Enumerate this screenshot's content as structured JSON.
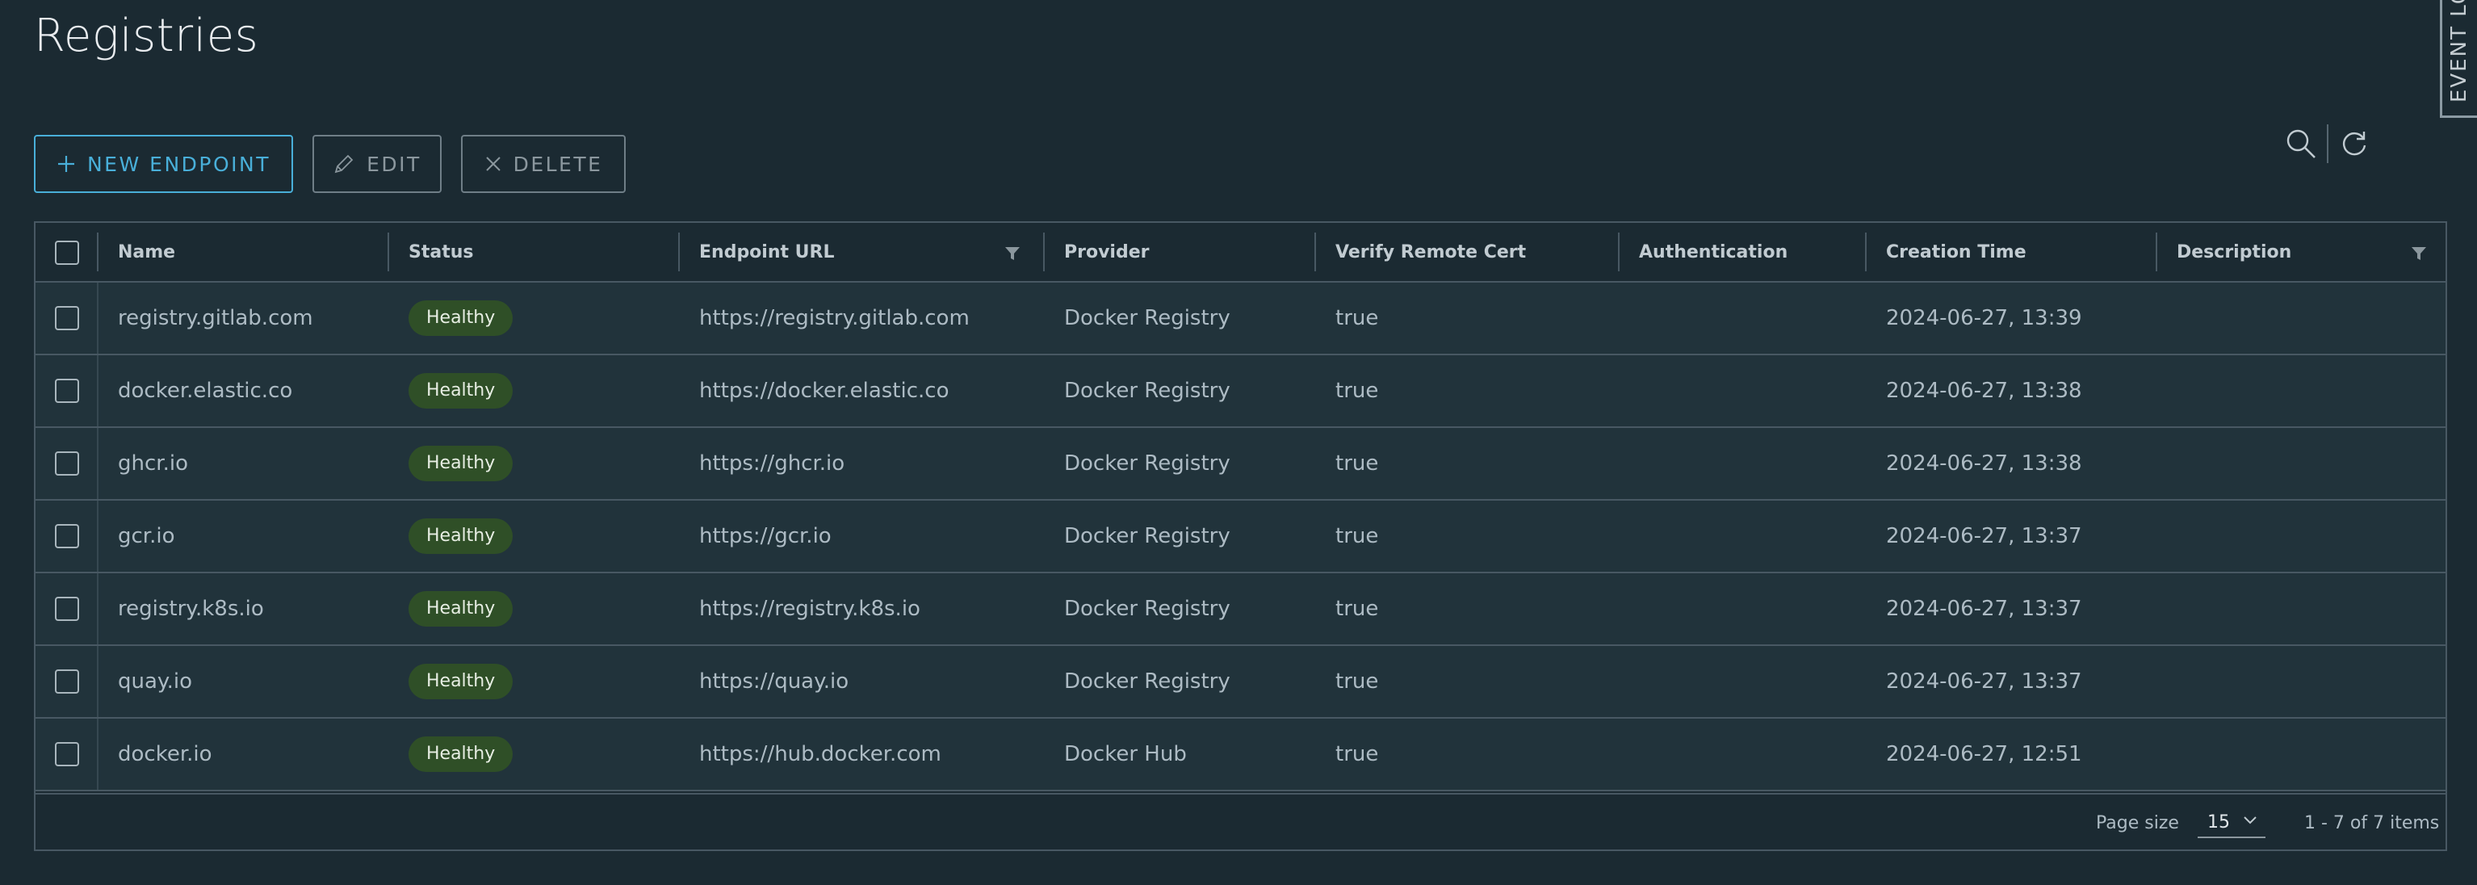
{
  "page": {
    "title": "Registries"
  },
  "event_tab": {
    "label": "EVENT LOG"
  },
  "toolbar": {
    "new_label": "NEW ENDPOINT",
    "edit_label": "EDIT",
    "delete_label": "DELETE"
  },
  "table": {
    "columns": [
      "Name",
      "Status",
      "Endpoint URL",
      "Provider",
      "Verify Remote Cert",
      "Authentication",
      "Creation Time",
      "Description"
    ],
    "rows": [
      {
        "name": "registry.gitlab.com",
        "status": "Healthy",
        "url": "https://registry.gitlab.com",
        "provider": "Docker Registry",
        "verify": "true",
        "auth": "",
        "created": "2024-06-27, 13:39",
        "description": ""
      },
      {
        "name": "docker.elastic.co",
        "status": "Healthy",
        "url": "https://docker.elastic.co",
        "provider": "Docker Registry",
        "verify": "true",
        "auth": "",
        "created": "2024-06-27, 13:38",
        "description": ""
      },
      {
        "name": "ghcr.io",
        "status": "Healthy",
        "url": "https://ghcr.io",
        "provider": "Docker Registry",
        "verify": "true",
        "auth": "",
        "created": "2024-06-27, 13:38",
        "description": ""
      },
      {
        "name": "gcr.io",
        "status": "Healthy",
        "url": "https://gcr.io",
        "provider": "Docker Registry",
        "verify": "true",
        "auth": "",
        "created": "2024-06-27, 13:37",
        "description": ""
      },
      {
        "name": "registry.k8s.io",
        "status": "Healthy",
        "url": "https://registry.k8s.io",
        "provider": "Docker Registry",
        "verify": "true",
        "auth": "",
        "created": "2024-06-27, 13:37",
        "description": ""
      },
      {
        "name": "quay.io",
        "status": "Healthy",
        "url": "https://quay.io",
        "provider": "Docker Registry",
        "verify": "true",
        "auth": "",
        "created": "2024-06-27, 13:37",
        "description": ""
      },
      {
        "name": "docker.io",
        "status": "Healthy",
        "url": "https://hub.docker.com",
        "provider": "Docker Hub",
        "verify": "true",
        "auth": "",
        "created": "2024-06-27, 12:51",
        "description": ""
      }
    ]
  },
  "footer": {
    "page_size_label": "Page size",
    "page_size_value": "15",
    "range_text": "1 - 7 of 7 items"
  },
  "colors": {
    "background": "#1b2a32",
    "row_background": "#21333b",
    "accent": "#49afd9",
    "badge_healthy": "#2f4f27",
    "border": "#485863"
  },
  "icons": [
    "plus-icon",
    "pencil-icon",
    "close-icon",
    "search-icon",
    "refresh-icon",
    "filter-icon",
    "chevron-down-icon"
  ]
}
